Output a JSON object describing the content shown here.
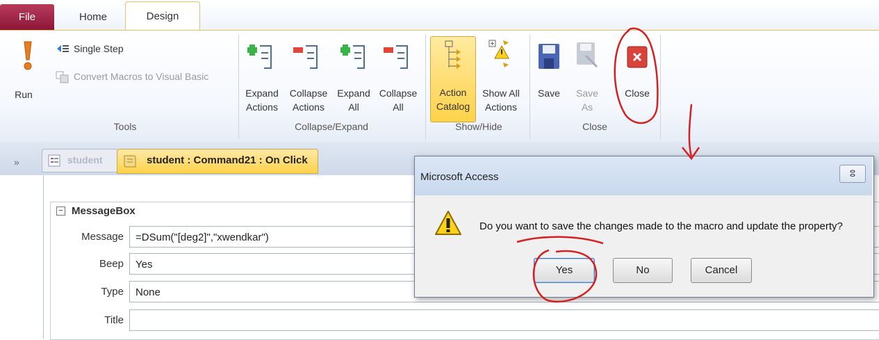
{
  "ribbon": {
    "tabs": {
      "file": "File",
      "home": "Home",
      "design": "Design"
    },
    "tools": {
      "run": "Run",
      "single_step": "Single Step",
      "convert": "Convert Macros to Visual Basic",
      "group_label": "Tools"
    },
    "collapse_expand": {
      "expand_actions": [
        "Expand",
        "Actions"
      ],
      "collapse_actions": [
        "Collapse",
        "Actions"
      ],
      "expand_all": [
        "Expand",
        "All"
      ],
      "collapse_all": [
        "Collapse",
        "All"
      ],
      "group_label": "Collapse/Expand"
    },
    "show_hide": {
      "action_catalog": [
        "Action",
        "Catalog"
      ],
      "show_all_actions": [
        "Show All",
        "Actions"
      ],
      "group_label": "Show/Hide"
    },
    "close_group": {
      "save": "Save",
      "save_as": [
        "Save",
        "As"
      ],
      "close": "Close",
      "group_label": "Close"
    }
  },
  "doc_tabs": {
    "collapse_glyph": "»",
    "student": "student",
    "macro": "student : Command21 : On Click"
  },
  "macro": {
    "action": "MessageBox",
    "args": [
      {
        "name": "Message",
        "value": "=DSum(\"[deg2]\",\"xwendkar\")"
      },
      {
        "name": "Beep",
        "value": "Yes"
      },
      {
        "name": "Type",
        "value": "None"
      },
      {
        "name": "Title",
        "value": ""
      }
    ]
  },
  "dialog": {
    "title": "Microsoft Access",
    "message": "Do you want to save the changes made to the macro and update the property?",
    "buttons": {
      "yes": "Yes",
      "no": "No",
      "cancel": "Cancel"
    },
    "close_glyph": "ⵓ"
  },
  "colors": {
    "file_tab": "#9c1e45",
    "annotation": "#d42020",
    "active_tab": "#ffd24a"
  }
}
